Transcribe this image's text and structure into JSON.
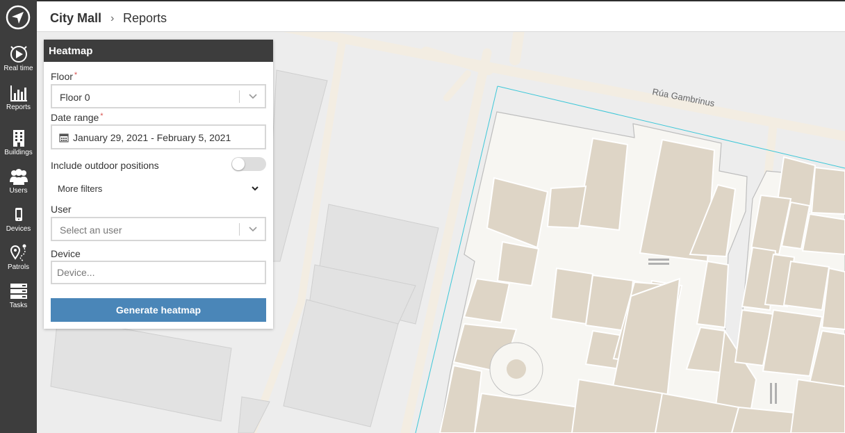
{
  "sidebar": {
    "logo_icon": "navigation-arrow-icon",
    "items": [
      {
        "label": "Real time",
        "icon": "play-radar-icon"
      },
      {
        "label": "Reports",
        "icon": "bar-chart-icon"
      },
      {
        "label": "Buildings",
        "icon": "building-icon"
      },
      {
        "label": "Users",
        "icon": "users-icon"
      },
      {
        "label": "Devices",
        "icon": "mobile-device-icon"
      },
      {
        "label": "Patrols",
        "icon": "route-pin-icon"
      },
      {
        "label": "Tasks",
        "icon": "task-list-icon"
      }
    ]
  },
  "header": {
    "breadcrumb_home": "City Mall",
    "breadcrumb_sep": "›",
    "breadcrumb_current": "Reports"
  },
  "map": {
    "street_label": "Rúa Gambrinus"
  },
  "panel": {
    "title": "Heatmap",
    "floor": {
      "label": "Floor",
      "required_mark": "*",
      "value": "Floor 0"
    },
    "date_range": {
      "label": "Date range",
      "required_mark": "*",
      "value": "January 29, 2021 - February 5, 2021"
    },
    "outdoor": {
      "label": "Include outdoor positions",
      "enabled": false
    },
    "more_filters": "More filters",
    "user": {
      "label": "User",
      "placeholder": "Select an user"
    },
    "device": {
      "label": "Device",
      "placeholder": "Device..."
    },
    "generate_button": "Generate heatmap"
  },
  "colors": {
    "sidebar_bg": "#3d3d3d",
    "panel_header_bg": "#3d3d3d",
    "primary_button": "#4a86b8",
    "required_mark": "#d9534f",
    "building_outline": "#3cc7d8",
    "shop_fill": "#ded5c6"
  }
}
